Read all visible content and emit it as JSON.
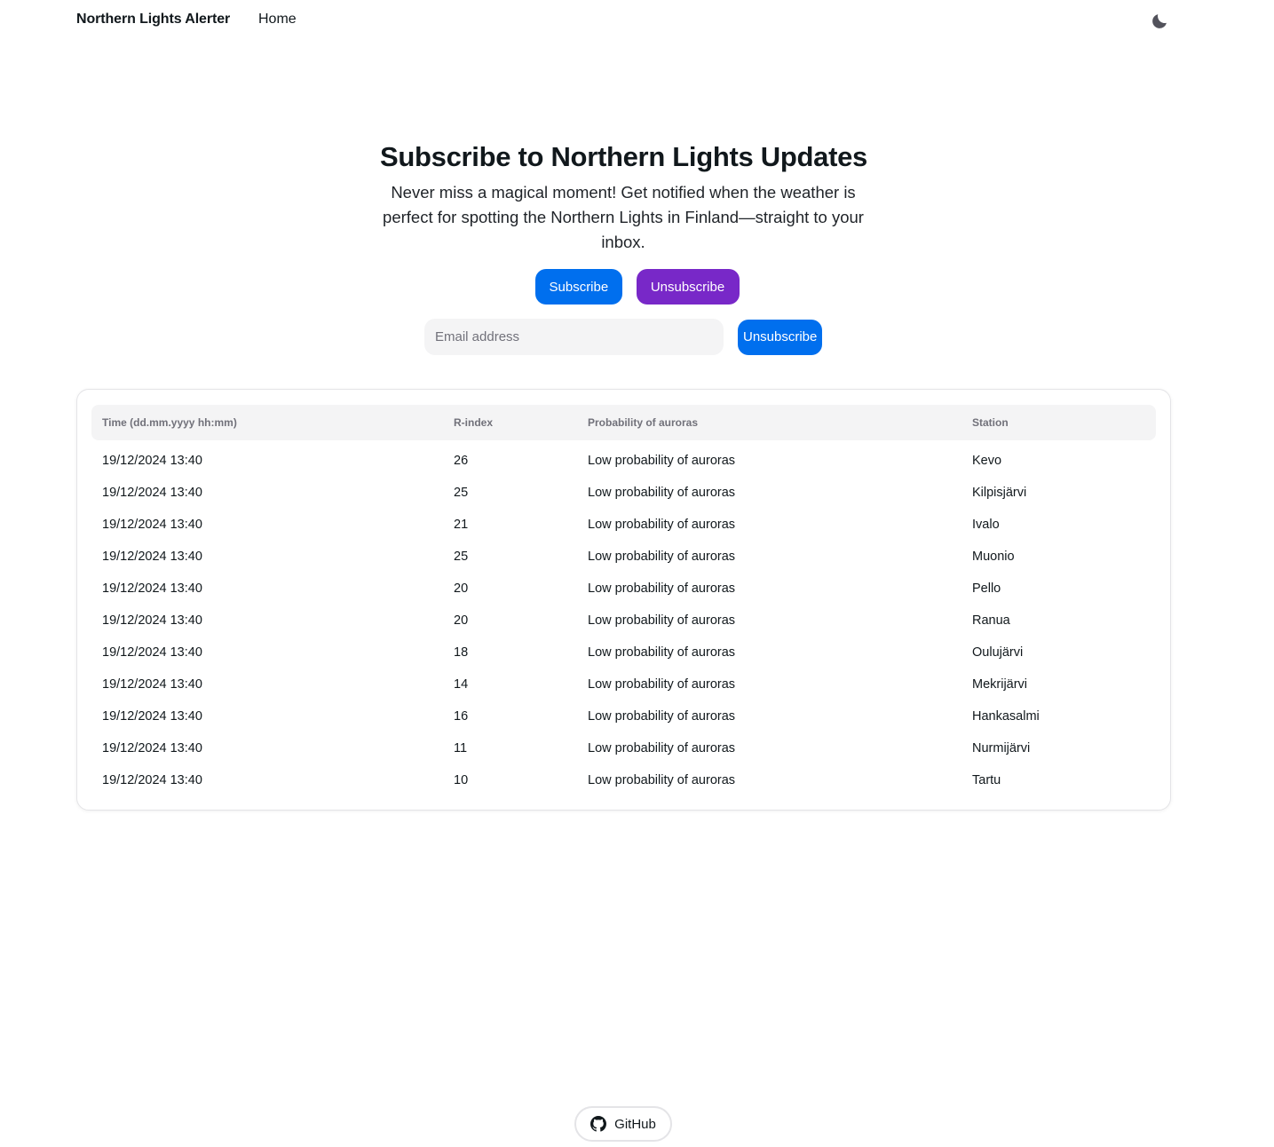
{
  "navbar": {
    "brand": "Northern Lights Alerter",
    "home_label": "Home",
    "theme_icon": "moon-icon"
  },
  "hero": {
    "title": "Subscribe to Northern Lights Updates",
    "description": "Never miss a magical moment! Get notified when the weather is perfect for spotting the Northern Lights in Finland—straight to your inbox.",
    "subscribe_label": "Subscribe",
    "unsubscribe_label": "Unsubscribe"
  },
  "email_form": {
    "placeholder": "Email address",
    "value": "",
    "submit_label": "Unsubscribe"
  },
  "table": {
    "headers": [
      "Time (dd.mm.yyyy hh:mm)",
      "R-index",
      "Probability of auroras",
      "Station"
    ],
    "rows": [
      {
        "time": "19/12/2024 13:40",
        "rindex": "26",
        "probability": "Low probability of auroras",
        "station": "Kevo"
      },
      {
        "time": "19/12/2024 13:40",
        "rindex": "25",
        "probability": "Low probability of auroras",
        "station": "Kilpisjärvi"
      },
      {
        "time": "19/12/2024 13:40",
        "rindex": "21",
        "probability": "Low probability of auroras",
        "station": "Ivalo"
      },
      {
        "time": "19/12/2024 13:40",
        "rindex": "25",
        "probability": "Low probability of auroras",
        "station": "Muonio"
      },
      {
        "time": "19/12/2024 13:40",
        "rindex": "20",
        "probability": "Low probability of auroras",
        "station": "Pello"
      },
      {
        "time": "19/12/2024 13:40",
        "rindex": "20",
        "probability": "Low probability of auroras",
        "station": "Ranua"
      },
      {
        "time": "19/12/2024 13:40",
        "rindex": "18",
        "probability": "Low probability of auroras",
        "station": "Oulujärvi"
      },
      {
        "time": "19/12/2024 13:40",
        "rindex": "14",
        "probability": "Low probability of auroras",
        "station": "Mekrijärvi"
      },
      {
        "time": "19/12/2024 13:40",
        "rindex": "16",
        "probability": "Low probability of auroras",
        "station": "Hankasalmi"
      },
      {
        "time": "19/12/2024 13:40",
        "rindex": "11",
        "probability": "Low probability of auroras",
        "station": "Nurmijärvi"
      },
      {
        "time": "19/12/2024 13:40",
        "rindex": "10",
        "probability": "Low probability of auroras",
        "station": "Tartu"
      }
    ]
  },
  "footer": {
    "github_label": "GitHub",
    "github_icon": "github-icon"
  },
  "colors": {
    "primary": "#006fee",
    "secondary": "#7828c8",
    "text": "#11181c",
    "muted": "#71717a",
    "surface": "#f4f4f5"
  }
}
